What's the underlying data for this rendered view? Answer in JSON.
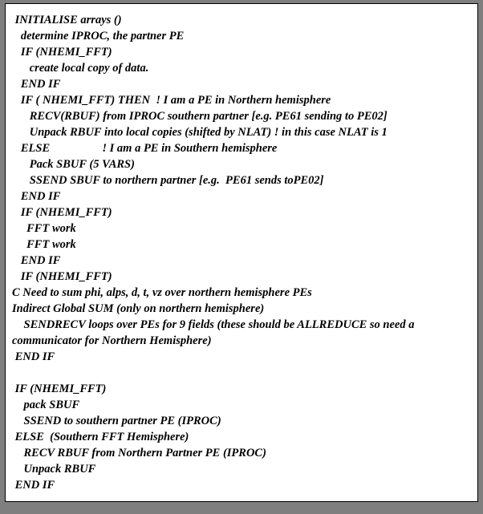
{
  "code": {
    "lines": [
      " INITIALISE arrays ()",
      "   determine IPROC, the partner PE",
      "   IF (NHEMI_FFT)",
      "      create local copy of data.",
      "   END IF",
      "   IF ( NHEMI_FFT) THEN  ! I am a PE in Northern hemisphere",
      "      RECV(RBUF) from IPROC southern partner [e.g. PE61 sending to PE02]",
      "      Unpack RBUF into local copies (shifted by NLAT) ! in this case NLAT is 1",
      "   ELSE                  ! I am a PE in Southern hemisphere",
      "      Pack SBUF (5 VARS)",
      "      SSEND SBUF to northern partner [e.g.  PE61 sends toPE02]",
      "   END IF",
      "   IF (NHEMI_FFT)",
      "     FFT work",
      "     FFT work",
      "   END IF",
      "   IF (NHEMI_FFT)",
      "C Need to sum phi, alps, d, t, vz over northern hemisphere PEs",
      "Indirect Global SUM (only on northern hemisphere)",
      "    SENDRECV loops over PEs for 9 fields (these should be ALLREDUCE so need a communicator for Northern Hemisphere)",
      " END IF",
      "",
      " IF (NHEMI_FFT)",
      "    pack SBUF",
      "    SSEND to southern partner PE (IPROC)",
      " ELSE  (Southern FFT Hemisphere)",
      "    RECV RBUF from Northern Partner PE (IPROC)",
      "    Unpack RBUF",
      " END IF"
    ]
  }
}
